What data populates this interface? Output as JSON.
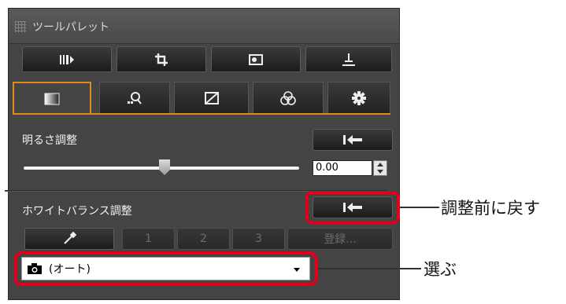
{
  "panel": {
    "title": "ツールパレット",
    "toolbar": [
      {
        "icon": "rgb-tool-icon"
      },
      {
        "icon": "crop-icon"
      },
      {
        "icon": "image-view-icon"
      },
      {
        "icon": "stamp-icon"
      }
    ],
    "tabs": [
      {
        "icon": "brightness-tab-icon",
        "active": true
      },
      {
        "icon": "zoom-detail-icon",
        "active": false
      },
      {
        "icon": "tone-curve-icon",
        "active": false
      },
      {
        "icon": "color-wheel-icon",
        "active": false
      },
      {
        "icon": "settings-gear-icon",
        "active": false
      }
    ],
    "brightness": {
      "label": "明るさ調整",
      "value": "0.00",
      "slider_level": 0.5
    },
    "white_balance": {
      "label": "ホワイトバランス調整",
      "slots": [
        "1",
        "2",
        "3"
      ],
      "register_label": "登録...",
      "selected": "(オート)"
    }
  },
  "annotations": {
    "reset_label": "調整前に戻す",
    "select_label": "選ぶ"
  },
  "colors": {
    "accent": "#e08a1e",
    "highlight": "#e0001b",
    "panel_bg": "#444444"
  }
}
